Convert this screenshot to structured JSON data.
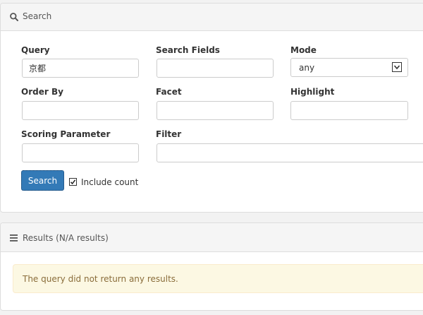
{
  "search_panel": {
    "title": "Search",
    "icon": "search-icon"
  },
  "form": {
    "query": {
      "label": "Query",
      "value": "京都"
    },
    "search_fields": {
      "label": "Search Fields",
      "value": ""
    },
    "mode": {
      "label": "Mode",
      "value": "any"
    },
    "order_by": {
      "label": "Order By",
      "value": ""
    },
    "facet": {
      "label": "Facet",
      "value": ""
    },
    "highlight": {
      "label": "Highlight",
      "value": ""
    },
    "scoring_parameter": {
      "label": "Scoring Parameter",
      "value": ""
    },
    "filter": {
      "label": "Filter",
      "value": ""
    },
    "search_button": "Search",
    "include_count": {
      "label": "Include count",
      "checked": true
    }
  },
  "results_panel": {
    "title": "Results (N/A results)",
    "icon": "list-icon",
    "empty_message": "The query did not return any results."
  },
  "colors": {
    "primary": "#337ab7",
    "warning_bg": "#fcf8e3",
    "warning_border": "#faebcc",
    "warning_text": "#8a6d3b"
  }
}
